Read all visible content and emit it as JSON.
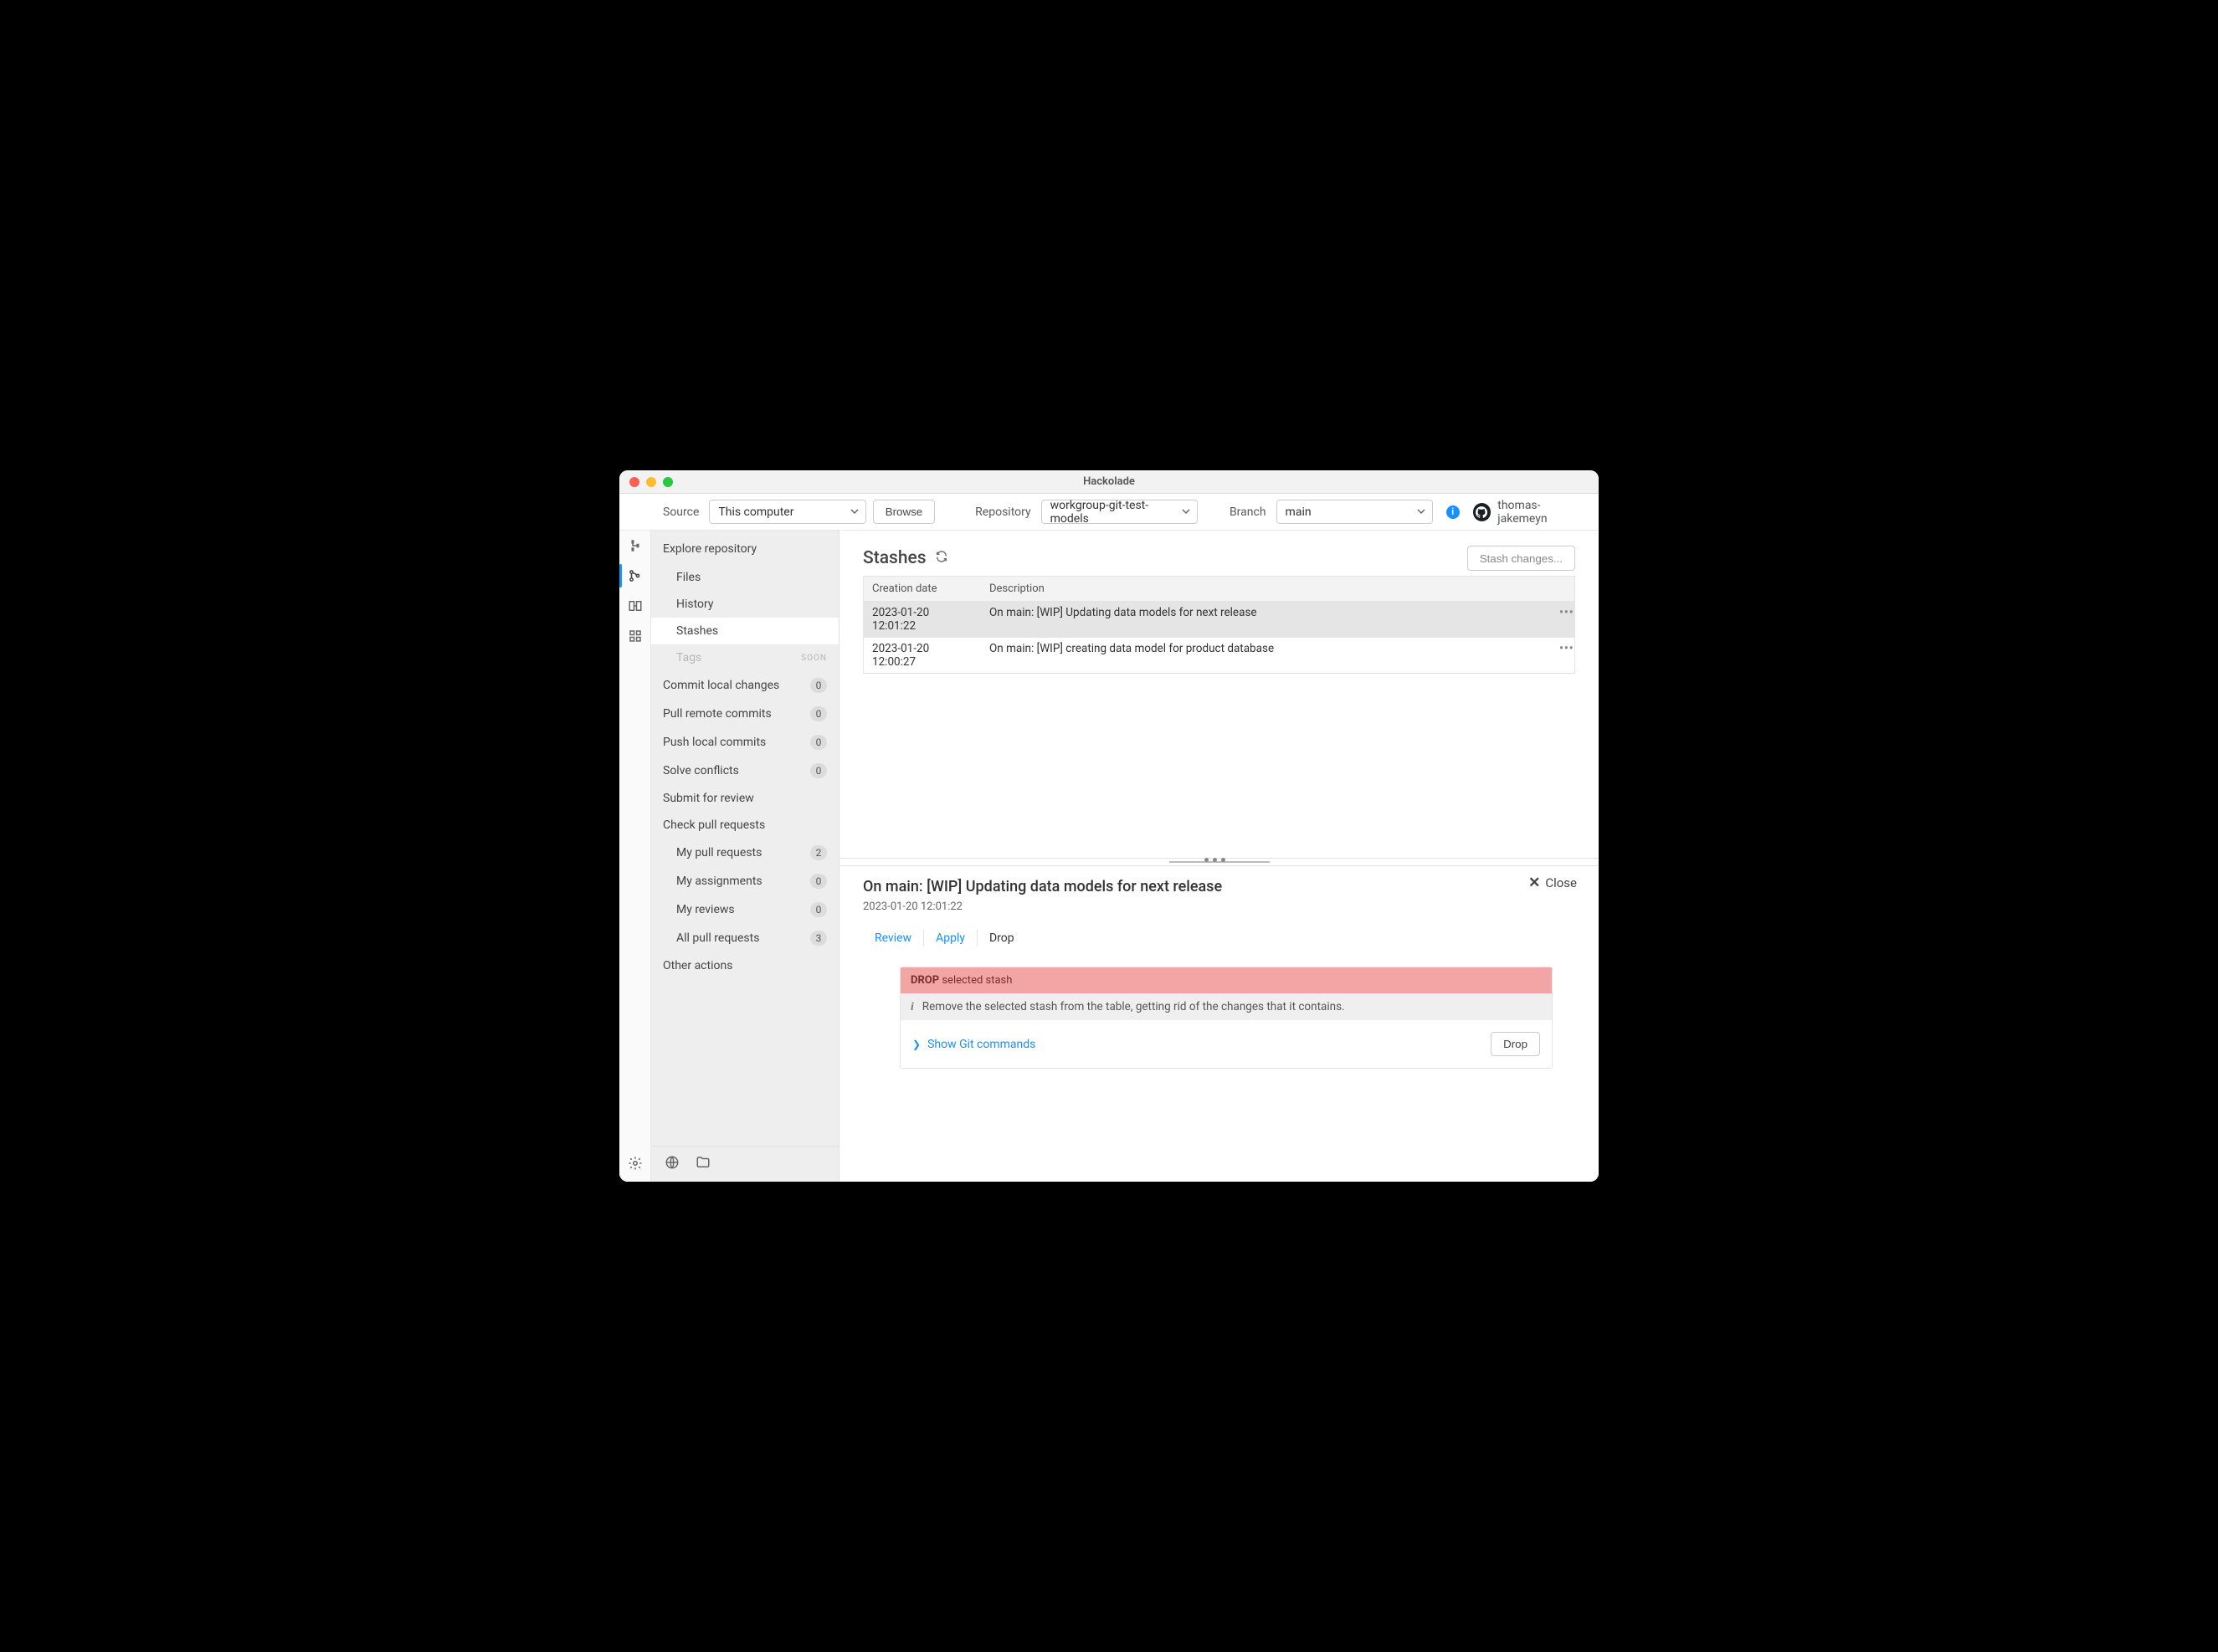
{
  "window": {
    "title": "Hackolade"
  },
  "toolbar": {
    "source_label": "Source",
    "source_value": "This computer",
    "browse_label": "Browse",
    "repository_label": "Repository",
    "repository_value": "workgroup-git-test-models",
    "branch_label": "Branch",
    "branch_value": "main",
    "username": "thomas-jakemeyn"
  },
  "sidebar": {
    "header": "Explore repository",
    "files": "Files",
    "history": "History",
    "stashes": "Stashes",
    "tags": "Tags",
    "tags_soon": "SOON",
    "commit_local": {
      "label": "Commit local changes",
      "count": "0"
    },
    "pull_remote": {
      "label": "Pull remote commits",
      "count": "0"
    },
    "push_local": {
      "label": "Push local commits",
      "count": "0"
    },
    "solve_conflicts": {
      "label": "Solve conflicts",
      "count": "0"
    },
    "submit_review": "Submit for review",
    "check_pr": "Check pull requests",
    "my_pr": {
      "label": "My pull requests",
      "count": "2"
    },
    "my_assign": {
      "label": "My assignments",
      "count": "0"
    },
    "my_reviews": {
      "label": "My reviews",
      "count": "0"
    },
    "all_pr": {
      "label": "All pull requests",
      "count": "3"
    },
    "other_actions": "Other actions"
  },
  "stashes": {
    "title": "Stashes",
    "button": "Stash changes...",
    "col_date": "Creation date",
    "col_desc": "Description",
    "rows": [
      {
        "date": "2023-01-20 12:01:22",
        "desc": "On main: [WIP] Updating data models for next release"
      },
      {
        "date": "2023-01-20 12:00:27",
        "desc": "On main: [WIP] creating data model for product database"
      }
    ]
  },
  "detail": {
    "title": "On main: [WIP] Updating data models for next release",
    "time": "2023-01-20 12:01:22",
    "close": "Close",
    "tabs": {
      "review": "Review",
      "apply": "Apply",
      "drop": "Drop"
    },
    "panel_header_strong": "DROP",
    "panel_header_rest": " selected stash",
    "panel_note": "Remove the selected stash from the table, getting rid of the changes that it contains.",
    "show_git": "Show Git commands",
    "drop_btn": "Drop"
  }
}
